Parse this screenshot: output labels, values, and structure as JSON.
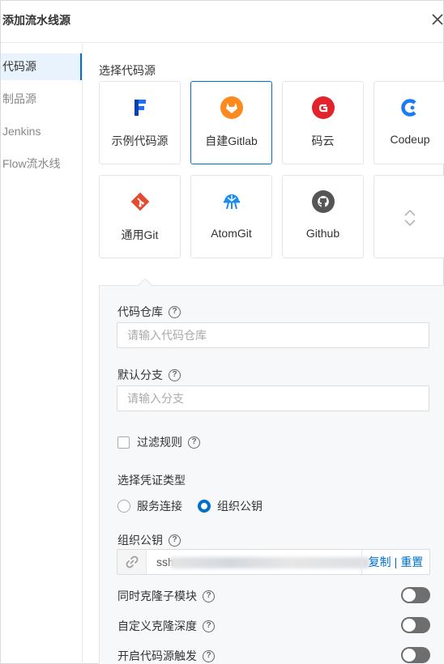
{
  "dialog": {
    "title": "添加流水线源",
    "close_glyph": "✕"
  },
  "sidebar": {
    "items": [
      {
        "label": "代码源",
        "active": true
      },
      {
        "label": "制品源"
      },
      {
        "label": "Jenkins"
      },
      {
        "label": "Flow流水线"
      }
    ]
  },
  "source": {
    "section_label": "选择代码源",
    "cards": [
      {
        "label": "示例代码源",
        "icon": "flow-f-icon",
        "color": "#1f6fff"
      },
      {
        "label": "自建Gitlab",
        "icon": "gitlab-icon",
        "color": "#fc8a1e",
        "selected": true
      },
      {
        "label": "码云",
        "icon": "gitee-icon",
        "color": "#e3232c"
      },
      {
        "label": "Codeup",
        "icon": "codeup-icon",
        "color": "#1b7cf5"
      },
      {
        "label": "通用Git",
        "icon": "git-icon",
        "color": "#e44c32"
      },
      {
        "label": "AtomGit",
        "icon": "atomgit-icon",
        "color": "#1d8cf0"
      },
      {
        "label": "Github",
        "icon": "github-icon",
        "color": "#555555"
      }
    ],
    "expand_icon": "chevron-updown-icon"
  },
  "form": {
    "repo": {
      "label": "代码仓库",
      "placeholder": "请输入代码仓库"
    },
    "branch": {
      "label": "默认分支",
      "placeholder": "请输入分支"
    },
    "filter": {
      "label": "过滤规则",
      "checked": false
    },
    "credential": {
      "label": "选择凭证类型",
      "options": [
        "服务连接",
        "组织公钥"
      ],
      "selected": "组织公钥"
    },
    "public_key": {
      "label": "组织公钥",
      "value_prefix": "ssh",
      "copy_label": "复制",
      "separator": "|",
      "reset_label": "重置"
    },
    "toggles": [
      {
        "label": "同时克隆子模块",
        "on": false
      },
      {
        "label": "自定义克隆深度",
        "on": false
      },
      {
        "label": "开启代码源触发",
        "on": false
      }
    ],
    "help_glyph": "?"
  },
  "colors": {
    "accent": "#0070cc",
    "active_bg": "#e8f3fd",
    "toggle_off": "#6e6e6e"
  }
}
